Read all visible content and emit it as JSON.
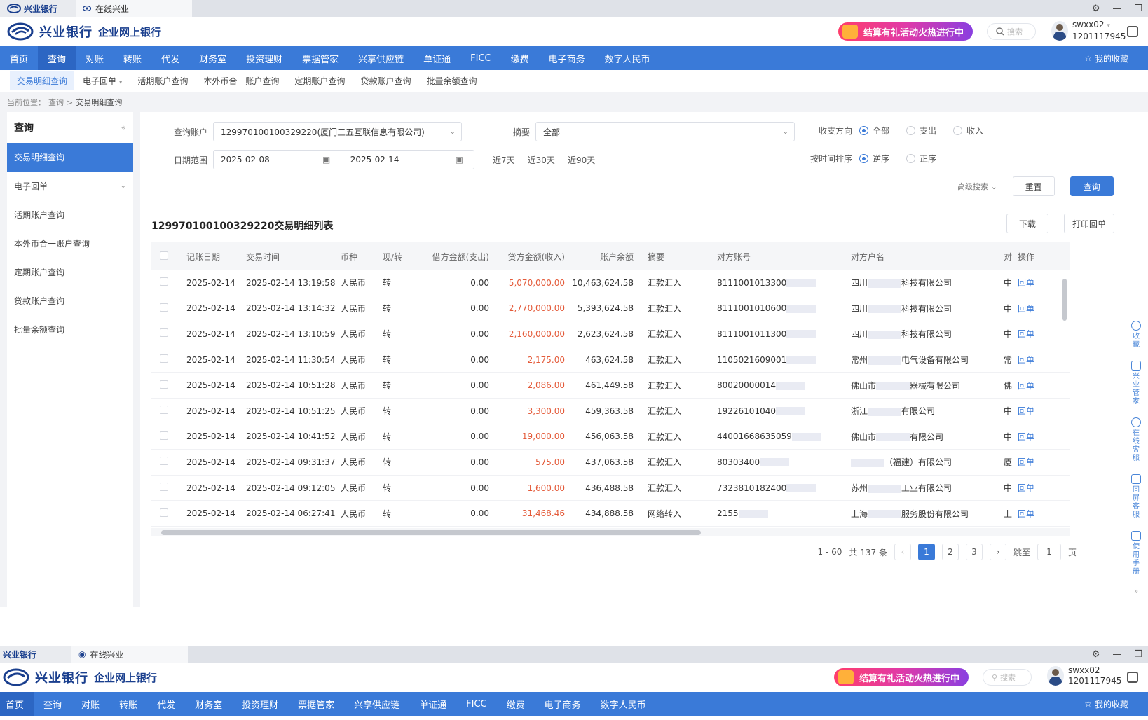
{
  "browser": {
    "logo_text": "兴业银行",
    "tab_label": "在线兴业",
    "controls": [
      "settings-icon",
      "minimize-icon",
      "restore-icon"
    ]
  },
  "header": {
    "brand_cn": "兴业银行",
    "brand_sub": "企业网上银行",
    "promo": "结算有礼活动火热进行中",
    "search_placeholder": "搜索",
    "username": "swxx02",
    "user_id": "1201117945"
  },
  "mainnav": {
    "items": [
      "首页",
      "查询",
      "对账",
      "转账",
      "代发",
      "财务室",
      "投资理财",
      "票据管家",
      "兴享供应链",
      "单证通",
      "FICC",
      "缴费",
      "电子商务",
      "数字人民币"
    ],
    "active_index": 1,
    "fav": "我的收藏"
  },
  "subnav": {
    "items": [
      "交易明细查询",
      "电子回单",
      "活期账户查询",
      "本外币合一账户查询",
      "定期账户查询",
      "贷款账户查询",
      "批量余额查询"
    ]
  },
  "breadcrumb": {
    "prefix": "当前位置：",
    "level1": "查询",
    "sep": ">",
    "current": "交易明细查询"
  },
  "sidebar": {
    "title": "查询",
    "collapse": "«",
    "items": [
      "交易明细查询",
      "电子回单",
      "活期账户查询",
      "本外币合一账户查询",
      "定期账户查询",
      "贷款账户查询",
      "批量余额查询"
    ]
  },
  "form": {
    "account_label": "查询账户",
    "account_value": "129970100100329220(厦门三五互联信息有限公司)",
    "summary_label": "摘要",
    "summary_value": "全部",
    "direction_label": "收支方向",
    "direction_options": [
      "全部",
      "支出",
      "收入"
    ],
    "direction_selected": 0,
    "date_label": "日期范围",
    "date_start": "2025-02-08",
    "date_sep": "-",
    "date_end": "2025-02-14",
    "quick": [
      "近7天",
      "近30天",
      "近90天"
    ],
    "sort_label": "按时间排序",
    "sort_options": [
      "逆序",
      "正序"
    ],
    "sort_selected": 0,
    "advanced": "高级搜索",
    "reset": "重置",
    "query": "查询"
  },
  "list": {
    "title": "129970100100329220交易明细列表",
    "download": "下载",
    "print": "打印回单",
    "columns": [
      "记账日期",
      "交易时间",
      "币种",
      "现/转",
      "借方金额(支出)",
      "贷方金额(收入)",
      "账户余额",
      "摘要",
      "对方账号",
      "对方户名",
      "对",
      "操作"
    ],
    "rows": [
      {
        "date": "2025-02-14",
        "time": "2025-02-14 13:19:58",
        "cur": "人民币",
        "type": "转",
        "debit": "0.00",
        "credit": "5,070,000.00",
        "balance": "10,463,624.58",
        "summary": "汇款汇入",
        "acct": "8111001013300",
        "name_pre": "四川",
        "name_post": "科技有限公司",
        "col": "中",
        "op": "回单"
      },
      {
        "date": "2025-02-14",
        "time": "2025-02-14 13:14:32",
        "cur": "人民币",
        "type": "转",
        "debit": "0.00",
        "credit": "2,770,000.00",
        "balance": "5,393,624.58",
        "summary": "汇款汇入",
        "acct": "8111001010600",
        "name_pre": "四川",
        "name_post": "科技有限公司",
        "col": "中",
        "op": "回单"
      },
      {
        "date": "2025-02-14",
        "time": "2025-02-14 13:10:59",
        "cur": "人民币",
        "type": "转",
        "debit": "0.00",
        "credit": "2,160,000.00",
        "balance": "2,623,624.58",
        "summary": "汇款汇入",
        "acct": "8111001011300",
        "name_pre": "四川",
        "name_post": "科技有限公司",
        "col": "中",
        "op": "回单"
      },
      {
        "date": "2025-02-14",
        "time": "2025-02-14 11:30:54",
        "cur": "人民币",
        "type": "转",
        "debit": "0.00",
        "credit": "2,175.00",
        "balance": "463,624.58",
        "summary": "汇款汇入",
        "acct": "1105021609001",
        "name_pre": "常州",
        "name_post": "电气设备有限公司",
        "col": "常",
        "op": "回单"
      },
      {
        "date": "2025-02-14",
        "time": "2025-02-14 10:51:28",
        "cur": "人民币",
        "type": "转",
        "debit": "0.00",
        "credit": "2,086.00",
        "balance": "461,449.58",
        "summary": "汇款汇入",
        "acct": "80020000014",
        "name_pre": "佛山市",
        "name_post": "器械有限公司",
        "col": "佛",
        "op": "回单"
      },
      {
        "date": "2025-02-14",
        "time": "2025-02-14 10:51:25",
        "cur": "人民币",
        "type": "转",
        "debit": "0.00",
        "credit": "3,300.00",
        "balance": "459,363.58",
        "summary": "汇款汇入",
        "acct": "19226101040",
        "name_pre": "浙江",
        "name_post": "有限公司",
        "col": "中",
        "op": "回单"
      },
      {
        "date": "2025-02-14",
        "time": "2025-02-14 10:41:52",
        "cur": "人民币",
        "type": "转",
        "debit": "0.00",
        "credit": "19,000.00",
        "balance": "456,063.58",
        "summary": "汇款汇入",
        "acct": "44001668635059",
        "name_pre": "佛山市",
        "name_post": "有限公司",
        "col": "中",
        "op": "回单"
      },
      {
        "date": "2025-02-14",
        "time": "2025-02-14 09:31:37",
        "cur": "人民币",
        "type": "转",
        "debit": "0.00",
        "credit": "575.00",
        "balance": "437,063.58",
        "summary": "汇款汇入",
        "acct": "80303400",
        "name_pre": "",
        "name_post": "（福建）有限公司",
        "col": "厦",
        "op": "回单"
      },
      {
        "date": "2025-02-14",
        "time": "2025-02-14 09:12:05",
        "cur": "人民币",
        "type": "转",
        "debit": "0.00",
        "credit": "1,600.00",
        "balance": "436,488.58",
        "summary": "汇款汇入",
        "acct": "7323810182400",
        "name_pre": "苏州",
        "name_post": "工业有限公司",
        "col": "中",
        "op": "回单"
      },
      {
        "date": "2025-02-14",
        "time": "2025-02-14 06:27:41",
        "cur": "人民币",
        "type": "转",
        "debit": "0.00",
        "credit": "31,468.46",
        "balance": "434,888.58",
        "summary": "网络转入",
        "acct": "2155",
        "name_pre": "上海",
        "name_post": "服务股份有限公司",
        "col": "上",
        "op": "回单"
      }
    ]
  },
  "pager": {
    "range": "1 - 60",
    "total": "共 137 条",
    "pages": [
      "1",
      "2",
      "3"
    ],
    "current_page": "1",
    "jump_label": "跳至",
    "jump_value": "1",
    "page_unit": "页"
  },
  "rail": [
    "收藏",
    "兴业管家",
    "在线客服",
    "同屏客服",
    "使用手册"
  ]
}
